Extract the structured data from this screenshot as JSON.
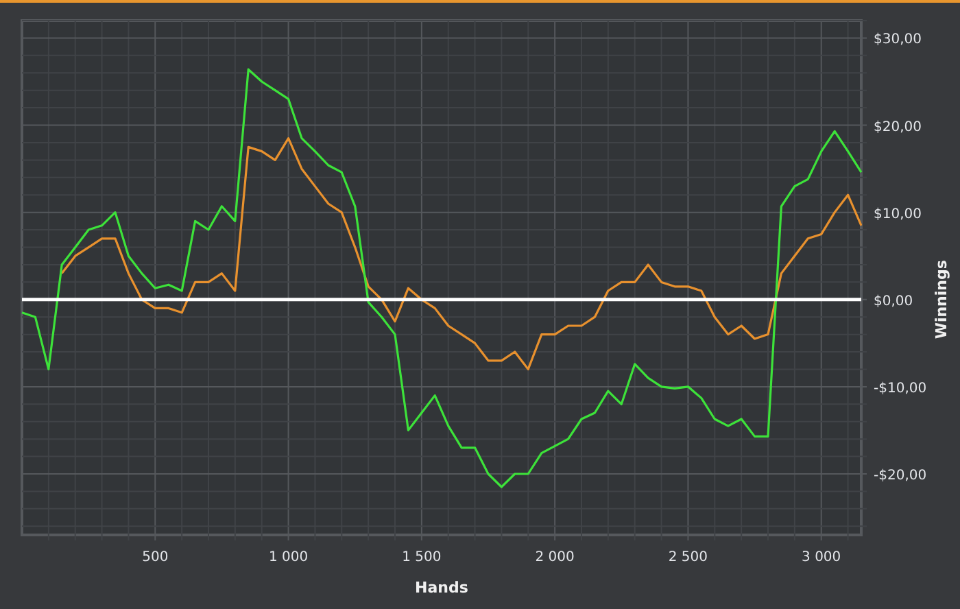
{
  "chart_data": {
    "type": "line",
    "grid": true,
    "xlabel": "Hands",
    "ylabel": "Winnings",
    "xlim": [
      0,
      3150
    ],
    "ylim": [
      -27,
      32
    ],
    "xticks": [
      {
        "value": 500,
        "label": "500"
      },
      {
        "value": 1000,
        "label": "1 000"
      },
      {
        "value": 1500,
        "label": "1 500"
      },
      {
        "value": 2000,
        "label": "2 000"
      },
      {
        "value": 2500,
        "label": "2 500"
      },
      {
        "value": 3000,
        "label": "3 000"
      }
    ],
    "yticks": [
      {
        "value": 30,
        "label": "$30,00"
      },
      {
        "value": 20,
        "label": "$20,00"
      },
      {
        "value": 10,
        "label": "$10,00"
      },
      {
        "value": 0,
        "label": "$0,00"
      },
      {
        "value": -10,
        "label": "-$10,00"
      },
      {
        "value": -20,
        "label": "-$20,00"
      }
    ],
    "x": [
      0,
      50,
      100,
      150,
      200,
      250,
      300,
      350,
      400,
      450,
      500,
      550,
      600,
      650,
      700,
      750,
      800,
      850,
      900,
      950,
      1000,
      1050,
      1100,
      1150,
      1200,
      1250,
      1300,
      1350,
      1400,
      1450,
      1500,
      1550,
      1600,
      1650,
      1700,
      1750,
      1800,
      1850,
      1900,
      1950,
      2000,
      2050,
      2100,
      2150,
      2200,
      2250,
      2300,
      2350,
      2400,
      2450,
      2500,
      2550,
      2600,
      2650,
      2700,
      2750,
      2800,
      2850,
      2900,
      2950,
      3000,
      3050,
      3100,
      3150
    ],
    "series": [
      {
        "color": "#e8912e",
        "values": [
          null,
          null,
          null,
          3,
          5,
          6,
          7,
          7,
          3,
          0,
          -1,
          -1,
          -1.5,
          2,
          2,
          3,
          1,
          17.5,
          17,
          16,
          18.5,
          15,
          13,
          11,
          10,
          6,
          1.5,
          0,
          -2.5,
          1.3,
          0,
          -1,
          -3,
          -4,
          -5,
          -7,
          -7,
          -6,
          -8,
          -4,
          -4,
          -3,
          -3,
          -2,
          1,
          2,
          2,
          4,
          2,
          1.5,
          1.5,
          1,
          -2,
          -4,
          -3,
          -4.5,
          -4,
          3,
          5,
          7,
          7.5,
          10,
          12,
          8.5
        ]
      },
      {
        "color": "#3de23a",
        "values": [
          -1.5,
          -2,
          -8,
          4,
          6,
          8,
          8.5,
          10,
          5,
          3,
          1.3,
          1.7,
          1,
          9,
          8,
          10.7,
          9,
          26.4,
          25,
          24,
          23,
          18.5,
          17,
          15.4,
          14.6,
          10.7,
          -0.3,
          -2,
          -4,
          -15,
          -13,
          -11,
          -14.5,
          -17,
          -17,
          -20,
          -21.5,
          -20,
          -20,
          -17.6,
          -16.8,
          -16,
          -13.7,
          -13,
          -10.5,
          -12,
          -7.4,
          -9,
          -10,
          -10.2,
          -10,
          -11.3,
          -13.7,
          -14.5,
          -13.7,
          -15.7,
          -15.7,
          10.7,
          13,
          13.8,
          17,
          19.3,
          17,
          14.6
        ]
      }
    ]
  }
}
